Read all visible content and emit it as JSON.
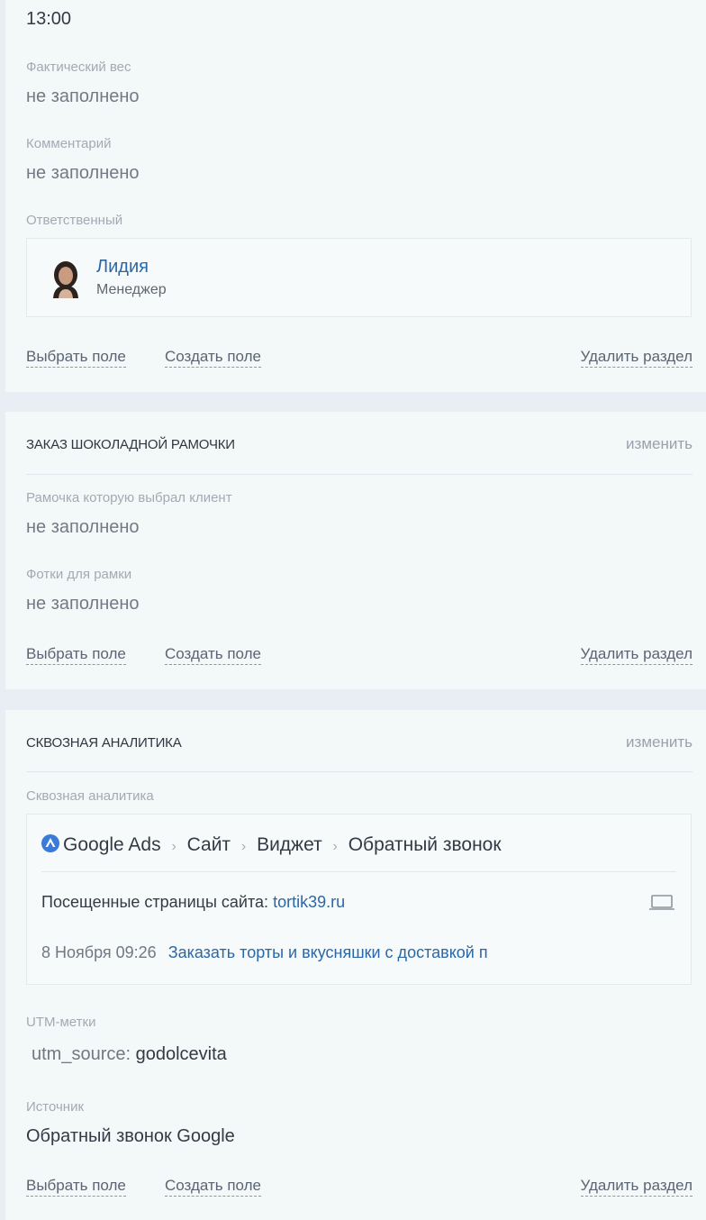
{
  "card1": {
    "time": "13:00",
    "fields": [
      {
        "label": "Фактический вес",
        "value": "не заполнено"
      },
      {
        "label": "Комментарий",
        "value": "не заполнено"
      }
    ],
    "responsible_label": "Ответственный",
    "user": {
      "name": "Лидия",
      "role": "Менеджер"
    },
    "actions": {
      "pick": "Выбрать поле",
      "create": "Создать поле",
      "delete": "Удалить раздел"
    }
  },
  "card2": {
    "title": "ЗАКАЗ ШОКОЛАДНОЙ РАМОЧКИ",
    "edit": "изменить",
    "fields": [
      {
        "label": "Рамочка которую выбрал клиент",
        "value": "не заполнено"
      },
      {
        "label": "Фотки для рамки",
        "value": "не заполнено"
      }
    ],
    "actions": {
      "pick": "Выбрать поле",
      "create": "Создать поле",
      "delete": "Удалить раздел"
    }
  },
  "card3": {
    "title": "СКВОЗНАЯ АНАЛИТИКА",
    "edit": "изменить",
    "analytics_label": "Сквозная аналитика",
    "breadcrumb": [
      "Google Ads",
      "Сайт",
      "Виджет",
      "Обратный звонок"
    ],
    "breadcrumb_sep": "›",
    "visited_label": "Посещенные страницы сайта:",
    "visited_site": "tortik39.ru",
    "visit_date": "8 Ноября 09:26",
    "visit_page": "Заказать торты и вкусняшки с доставкой п",
    "utm_label": "UTM-метки",
    "utm_key": "utm_source:",
    "utm_value": "godolcevita",
    "source_label": "Источник",
    "source_value": "Обратный звонок Google",
    "actions": {
      "pick": "Выбрать поле",
      "create": "Создать поле",
      "delete": "Удалить раздел"
    }
  }
}
